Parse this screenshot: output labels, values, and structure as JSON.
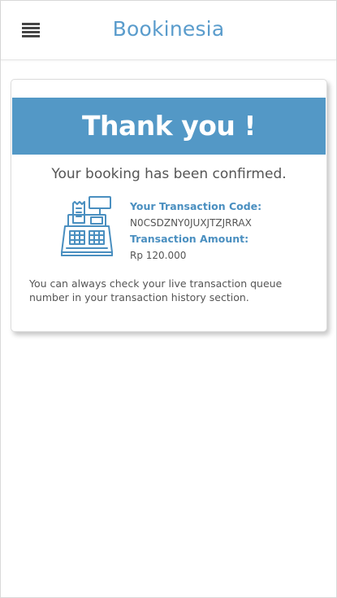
{
  "header": {
    "title": "Bookinesia",
    "menu_icon": "hamburger-menu-icon"
  },
  "card": {
    "heading": "Thank you !",
    "confirmation": "Your booking has been confirmed.",
    "icon": "cash-register-icon",
    "transaction_code_label": "Your Transaction Code:",
    "transaction_code": "N0CSDZNY0JUXJTZJRRAX",
    "transaction_amount_label": "Transaction Amount:",
    "transaction_amount": "Rp 120.000",
    "note": "You can always check your live transaction queue number in your transaction history section."
  },
  "colors": {
    "brand": "#5a9ccc",
    "banner": "#5398c6"
  }
}
